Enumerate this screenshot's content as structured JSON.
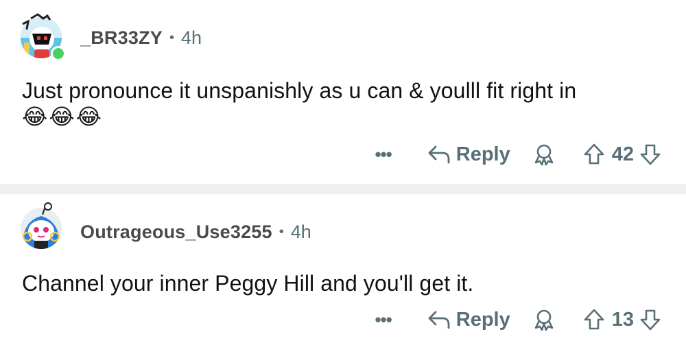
{
  "comments": [
    {
      "username": "_BR33ZY",
      "separator": "•",
      "age": "4h",
      "body": "Just pronounce it unspanishly as u can & youlll fit right in",
      "emojis": [
        "😂",
        "😂",
        "😂"
      ],
      "online": true,
      "actions": {
        "more": "•••",
        "reply": "Reply",
        "score": "42"
      }
    },
    {
      "username": "Outrageous_Use3255",
      "separator": "•",
      "age": "4h",
      "body": "Channel your inner Peggy Hill and you'll get it.",
      "emojis": [],
      "online": false,
      "actions": {
        "more": "•••",
        "reply": "Reply",
        "score": "13"
      }
    }
  ],
  "icons": {
    "reply": "reply-arrow-icon",
    "award": "award-icon",
    "upvote": "upvote-arrow-icon",
    "downvote": "downvote-arrow-icon"
  },
  "colors": {
    "meta_text": "#576f76",
    "online": "#46d160",
    "divider": "#edeff1"
  }
}
